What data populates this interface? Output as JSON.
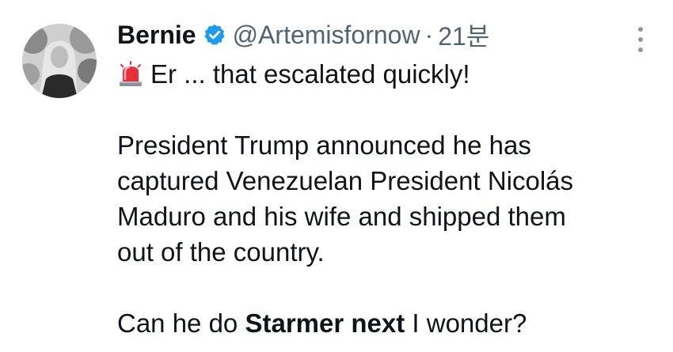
{
  "user": {
    "display_name": "Bernie",
    "handle": "@Artemisfornow",
    "separator": "·",
    "time": "21분"
  },
  "tweet": {
    "emoji_icon": "police-light-icon",
    "line1": "Er ... that escalated quickly!",
    "para2": [
      "President Trump announced he has",
      "captured Venezuelan President Nicolás",
      "Maduro and his wife and shipped them",
      "out of the country."
    ],
    "final_pre": "Can he do ",
    "final_bold": "Starmer next",
    "final_post": " I wonder?"
  },
  "colors": {
    "verified": "#1d9bf0",
    "muted_text": "#536471",
    "text": "#0f1419"
  }
}
